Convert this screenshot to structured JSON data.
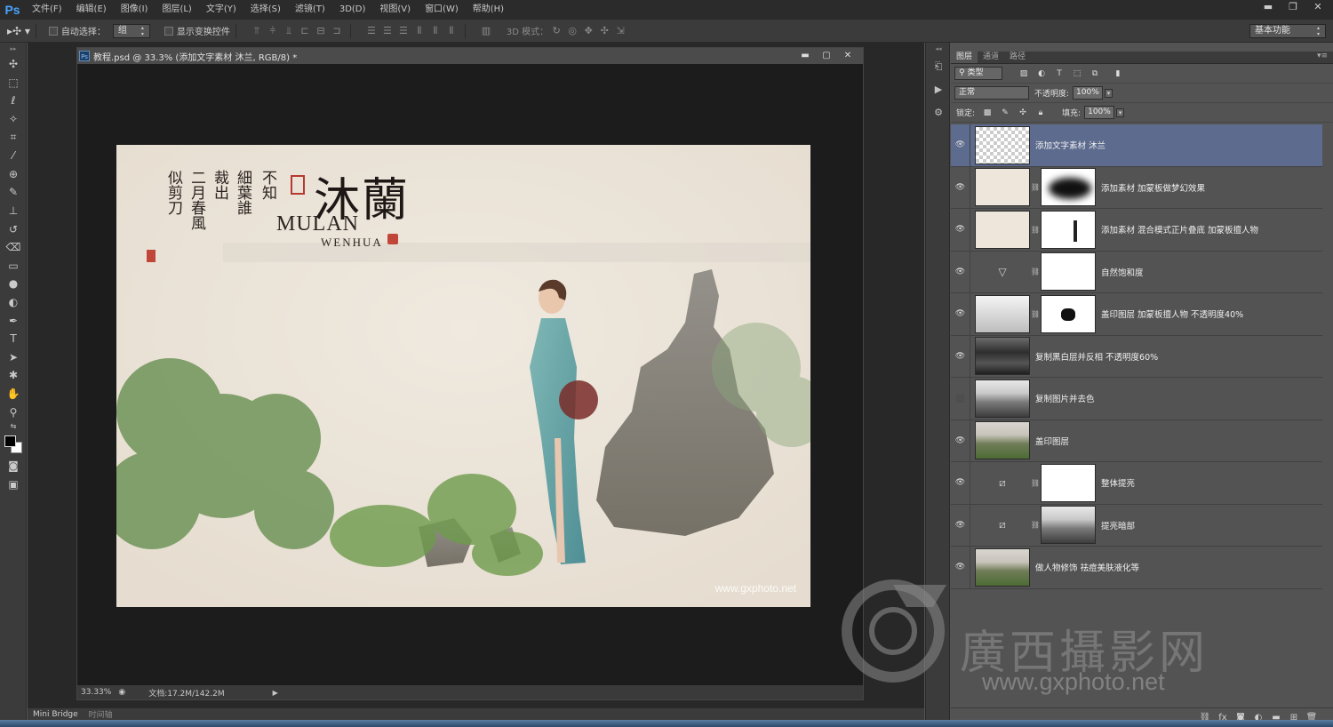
{
  "app": {
    "logo": "Ps"
  },
  "menu": [
    "文件(F)",
    "编辑(E)",
    "图像(I)",
    "图层(L)",
    "文字(Y)",
    "选择(S)",
    "滤镜(T)",
    "3D(D)",
    "视图(V)",
    "窗口(W)",
    "帮助(H)"
  ],
  "options": {
    "auto_select_label": "自动选择：",
    "auto_select_value": "组",
    "show_transform_label": "显示变换控件",
    "mode3d_label": "3D 模式：",
    "workspace": "基本功能"
  },
  "document": {
    "title": "教程.psd @ 33.3% (添加文字素材  沐兰, RGB/8) *",
    "zoom": "33.33%",
    "doc_info": "文档:17.2M/142.2M"
  },
  "image": {
    "title_cn": "沐蘭",
    "title_en": "MULAN",
    "title_en2": "WENHUA",
    "watermark": "www.gxphoto.net",
    "verse": [
      "不知",
      "細葉誰",
      "裁出",
      "二月春風",
      "似剪刀"
    ]
  },
  "layers_panel": {
    "tabs": [
      "图层",
      "通道",
      "路径"
    ],
    "filter_type": "类型",
    "blend_mode": "正常",
    "opacity_label": "不透明度:",
    "opacity_value": "100%",
    "lock_label": "锁定:",
    "fill_label": "填充:",
    "fill_value": "100%",
    "layers": [
      {
        "name": "添加文字素材  沐兰",
        "visible": true
      },
      {
        "name": "添加素材  加蒙板做梦幻效果",
        "visible": true
      },
      {
        "name": "添加素材  混合模式正片叠底  加蒙板擅人物",
        "visible": true
      },
      {
        "name": "自然饱和度",
        "visible": true
      },
      {
        "name": "盖印图层  加蒙板擅人物    不透明度40%",
        "visible": true
      },
      {
        "name": "复制黑白层并反相    不透明度60%",
        "visible": true
      },
      {
        "name": "复制图片并去色",
        "visible": false
      },
      {
        "name": "盖印图层",
        "visible": true
      },
      {
        "name": "整体提亮",
        "visible": true
      },
      {
        "name": "提亮暗部",
        "visible": true
      },
      {
        "name": "做人物修饰  祛痘美肤液化等",
        "visible": true
      }
    ]
  },
  "bottom_tabs": [
    "Mini Bridge",
    "时间轴"
  ],
  "site": {
    "name": "廣西攝影网",
    "url": "www.gxphoto.net"
  }
}
